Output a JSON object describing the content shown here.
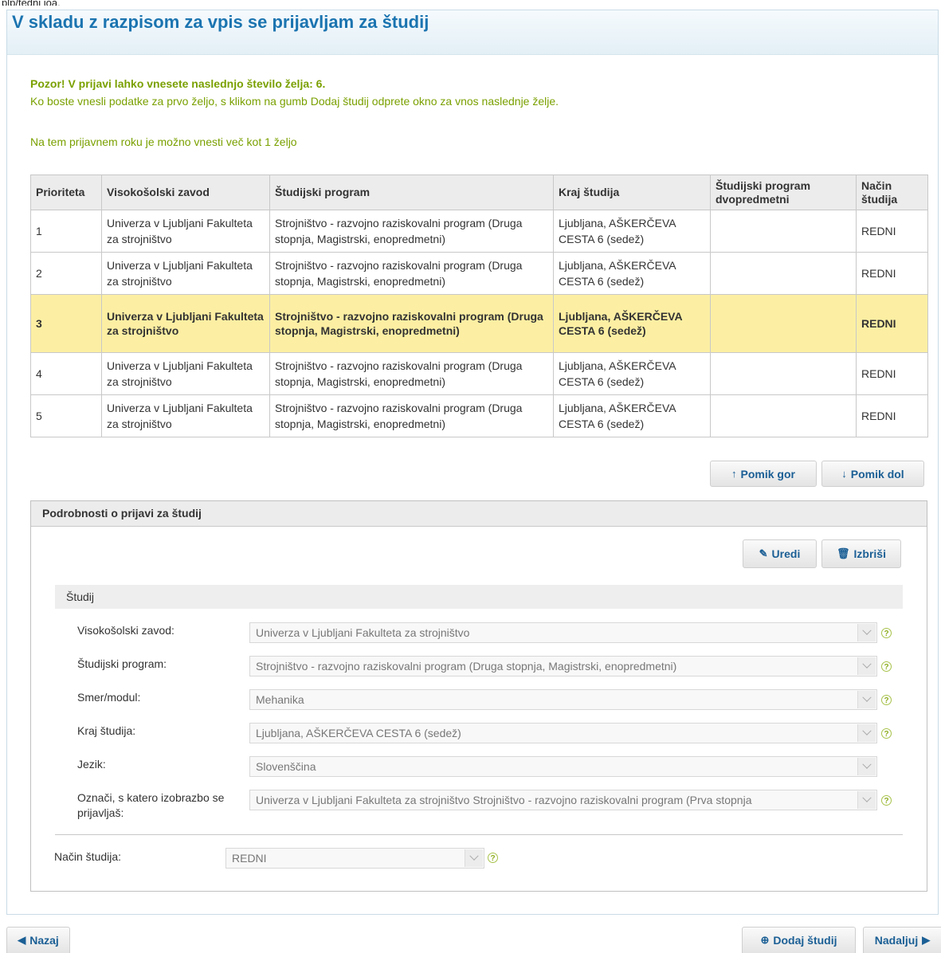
{
  "page_top_fragment": "plp/tedni ioa.",
  "title": "V skladu z razpisom za vpis se prijavljam za študij",
  "notice": {
    "line1": "Pozor! V prijavi lahko vnesete naslednjo število želja: 6.",
    "line2": "Ko boste vnesli podatke za prvo željo, s klikom na gumb Dodaj študij odprete okno za vnos naslednje želje.",
    "line3": "Na tem prijavnem roku je možno vnesti več kot 1 željo"
  },
  "table": {
    "headers": [
      "Prioriteta",
      "Visokošolski zavod",
      "Študijski program",
      "Kraj študija",
      "Študijski program dvopredmetni",
      "Način študija"
    ],
    "rows": [
      {
        "prioriteta": "1",
        "zavod": "Univerza v Ljubljani Fakulteta za strojništvo",
        "program": "Strojništvo - razvojno raziskovalni program (Druga stopnja, Magistrski, enopredmetni)",
        "kraj": "Ljubljana, AŠKERČEVA CESTA 6 (sedež)",
        "dvopredmetni": "",
        "nacin": "REDNI"
      },
      {
        "prioriteta": "2",
        "zavod": "Univerza v Ljubljani Fakulteta za strojništvo",
        "program": "Strojništvo - razvojno raziskovalni program (Druga stopnja, Magistrski, enopredmetni)",
        "kraj": "Ljubljana, AŠKERČEVA CESTA 6 (sedež)",
        "dvopredmetni": "",
        "nacin": "REDNI"
      },
      {
        "prioriteta": "3",
        "zavod": "Univerza v Ljubljani Fakulteta za strojništvo",
        "program": "Strojništvo - razvojno raziskovalni program (Druga stopnja, Magistrski, enopredmetni)",
        "kraj": "Ljubljana, AŠKERČEVA CESTA 6 (sedež)",
        "dvopredmetni": "",
        "nacin": "REDNI",
        "selected": true
      },
      {
        "prioriteta": "4",
        "zavod": "Univerza v Ljubljani Fakulteta za strojništvo",
        "program": "Strojništvo - razvojno raziskovalni program (Druga stopnja, Magistrski, enopredmetni)",
        "kraj": "Ljubljana, AŠKERČEVA CESTA 6 (sedež)",
        "dvopredmetni": "",
        "nacin": "REDNI"
      },
      {
        "prioriteta": "5",
        "zavod": "Univerza v Ljubljani Fakulteta za strojništvo",
        "program": "Strojništvo - razvojno raziskovalni program (Druga stopnja, Magistrski, enopredmetni)",
        "kraj": "Ljubljana, AŠKERČEVA CESTA 6 (sedež)",
        "dvopredmetni": "",
        "nacin": "REDNI"
      }
    ]
  },
  "buttons": {
    "move_up": "Pomik gor",
    "move_down": "Pomik dol",
    "edit": "Uredi",
    "delete": "Izbriši",
    "back": "Nazaj",
    "add_study": "Dodaj študij",
    "continue": "Nadaljuj"
  },
  "details": {
    "header": "Podrobnosti o prijavi za študij",
    "section": "Študij",
    "fields": [
      {
        "label": "Visokošolski zavod:",
        "value": "Univerza v Ljubljani Fakulteta za strojništvo"
      },
      {
        "label": "Študijski program:",
        "value": "Strojništvo - razvojno raziskovalni program (Druga stopnja, Magistrski, enopredmetni)"
      },
      {
        "label": "Smer/modul:",
        "value": "Mehanika"
      },
      {
        "label": "Kraj študija:",
        "value": "Ljubljana, AŠKERČEVA CESTA 6 (sedež)"
      },
      {
        "label": "Jezik:",
        "value": "Slovenščina"
      },
      {
        "label": "Označi, s katero izobrazbo se prijavljaš:",
        "value": "Univerza v Ljubljani Fakulteta za strojništvo Strojništvo - razvojno raziskovalni program (Prva stopnja"
      }
    ],
    "nacin_label": "Način študija:",
    "nacin_value": "REDNI"
  },
  "help_glyph": "?",
  "colors": {
    "title": "#1b74b0",
    "notice": "#7aa000",
    "selected_row": "#fcefa3",
    "button_text": "#1b5f95"
  }
}
